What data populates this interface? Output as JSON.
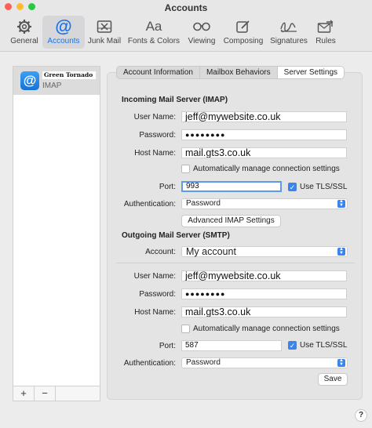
{
  "window": {
    "title": "Accounts"
  },
  "toolbar": {
    "tabs": [
      {
        "label": "General",
        "icon": "gear-icon"
      },
      {
        "label": "Accounts",
        "icon": "at-sign-icon"
      },
      {
        "label": "Junk Mail",
        "icon": "junk-tray-icon"
      },
      {
        "label": "Fonts & Colors",
        "icon": "font-aa-icon"
      },
      {
        "label": "Viewing",
        "icon": "glasses-icon"
      },
      {
        "label": "Composing",
        "icon": "compose-pencil-icon"
      },
      {
        "label": "Signatures",
        "icon": "signature-icon"
      },
      {
        "label": "Rules",
        "icon": "rules-envelope-icon"
      }
    ],
    "active_tab": "Accounts"
  },
  "sidebar": {
    "account": {
      "name": "Green Tornado",
      "type": "IMAP",
      "icon_glyph": "@"
    },
    "add_label": "+",
    "remove_label": "−"
  },
  "segments": {
    "items": [
      "Account Information",
      "Mailbox Behaviors",
      "Server Settings"
    ],
    "active": "Server Settings"
  },
  "incoming": {
    "title": "Incoming Mail Server (IMAP)",
    "user_name_label": "User Name:",
    "user_name": "jeff@mywebsite.co.uk",
    "password_label": "Password:",
    "password_mask": "●●●●●●●●",
    "host_label": "Host Name:",
    "host": "mail.gts3.co.uk",
    "auto_manage_label": "Automatically manage connection settings",
    "port_label": "Port:",
    "port": "993",
    "tls_label": "Use TLS/SSL",
    "auth_label": "Authentication:",
    "auth_value": "Password",
    "advanced_button": "Advanced IMAP Settings"
  },
  "outgoing": {
    "title": "Outgoing Mail Server (SMTP)",
    "account_label": "Account:",
    "account_value": "My account",
    "user_name_label": "User Name:",
    "user_name": "jeff@mywebsite.co.uk",
    "password_label": "Password:",
    "password_mask": "●●●●●●●●",
    "host_label": "Host Name:",
    "host": "mail.gts3.co.uk",
    "auto_manage_label": "Automatically manage connection settings",
    "port_label": "Port:",
    "port": "587",
    "tls_label": "Use TLS/SSL",
    "auth_label": "Authentication:",
    "auth_value": "Password"
  },
  "footer": {
    "save_label": "Save",
    "help_label": "?"
  },
  "colors": {
    "accent": "#1a73e8",
    "checkbox_on": "#3a84f0"
  }
}
